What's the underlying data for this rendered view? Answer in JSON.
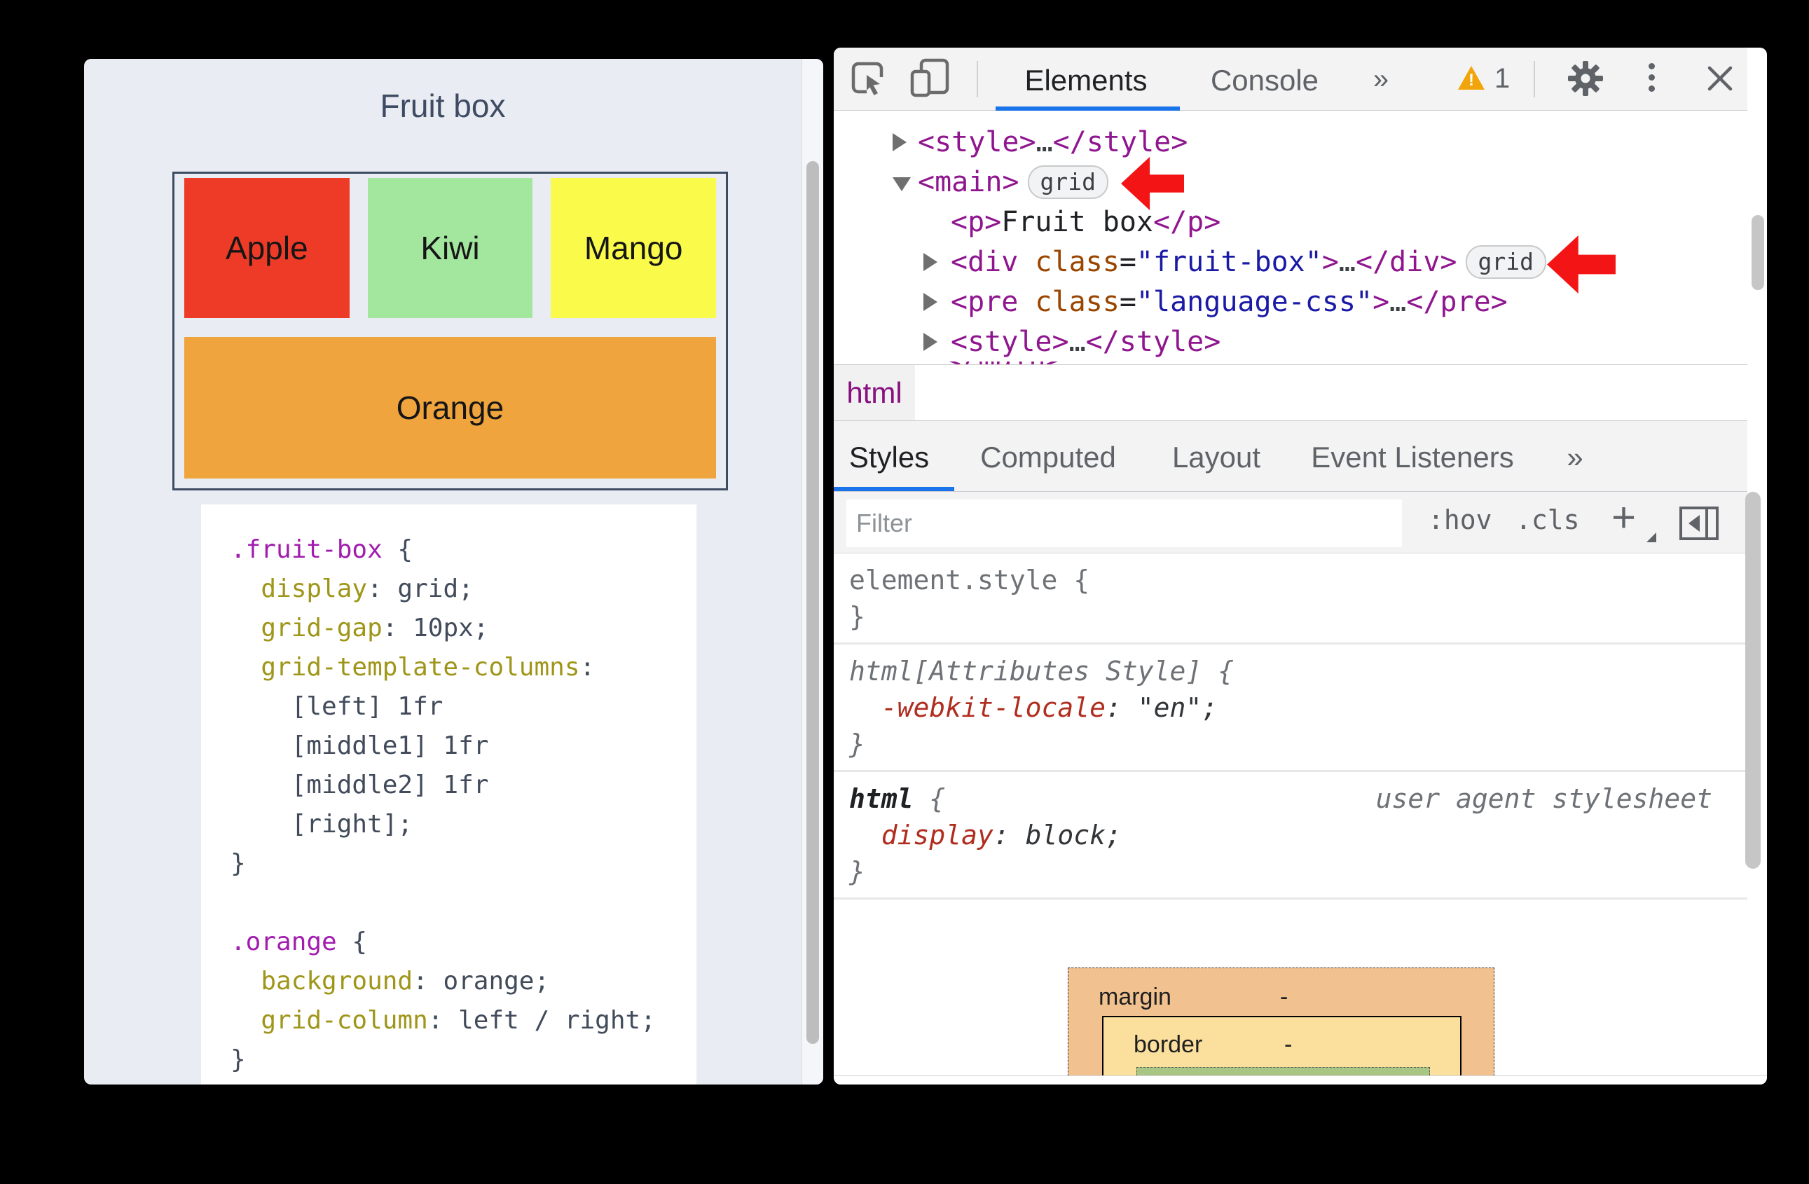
{
  "page": {
    "title": "Fruit box",
    "fruits": [
      {
        "label": "Apple",
        "color": "#ee3b28"
      },
      {
        "label": "Kiwi",
        "color": "#a3e69e"
      },
      {
        "label": "Mango",
        "color": "#fafa4a"
      },
      {
        "label": "Orange",
        "color": "#efa43d"
      }
    ],
    "code": {
      "lines": [
        {
          "a": ".fruit-box",
          "b": " {"
        },
        {
          "a": "  display",
          "b": ": grid;"
        },
        {
          "a": "  grid-gap",
          "b": ": 10px;"
        },
        {
          "a": "  grid-template-columns",
          "b": ":"
        },
        {
          "b": "    [left] 1fr"
        },
        {
          "b": "    [middle1] 1fr"
        },
        {
          "b": "    [middle2] 1fr"
        },
        {
          "b": "    [right];"
        },
        {
          "b": "}"
        },
        {
          "b": ""
        },
        {
          "a": ".orange",
          "b": " {"
        },
        {
          "a": "  background",
          "b": ": orange;"
        },
        {
          "a": "  grid-column",
          "b": ": left / right;"
        },
        {
          "b": "}"
        }
      ]
    }
  },
  "devtools": {
    "toolbar": {
      "tab_elements": "Elements",
      "tab_console": "Console",
      "more_tabs": "»",
      "warning_count": "1"
    },
    "dom": {
      "rows": [
        {
          "parts": [
            {
              "t": "<style>"
            },
            {
              "t": "…"
            },
            {
              "t": "</style>"
            }
          ]
        },
        {
          "parts": [
            {
              "t": "<main>"
            }
          ],
          "badge": "grid"
        },
        {
          "parts": [
            {
              "t": "<p>"
            },
            {
              "t": "Fruit box"
            },
            {
              "t": "</p>"
            }
          ]
        },
        {
          "parts": [
            {
              "t": "<div"
            },
            {
              "t": " class"
            },
            {
              "t": "="
            },
            {
              "t": "\"fruit-box\""
            },
            {
              "t": ">"
            },
            {
              "t": "…"
            },
            {
              "t": "</div>"
            }
          ],
          "badge": "grid"
        },
        {
          "parts": [
            {
              "t": "<pre"
            },
            {
              "t": " class"
            },
            {
              "t": "="
            },
            {
              "t": "\"language-css\""
            },
            {
              "t": ">"
            },
            {
              "t": "…"
            },
            {
              "t": "</pre>"
            }
          ]
        },
        {
          "parts": [
            {
              "t": "<style>"
            },
            {
              "t": "…"
            },
            {
              "t": "</style>"
            }
          ]
        },
        {
          "parts": [
            {
              "t": "</main>"
            }
          ]
        }
      ]
    },
    "breadcrumb": {
      "item": "html"
    },
    "sidebar_tabs": {
      "styles": "Styles",
      "computed": "Computed",
      "layout": "Layout",
      "event_listeners": "Event Listeners",
      "more": "»"
    },
    "filter": {
      "placeholder": "Filter",
      "pseudo_toggle": ":hov",
      "class_toggle": ".cls",
      "new_rule": "+"
    },
    "rules": {
      "element_style": {
        "open": "element.style {",
        "close": "}"
      },
      "attributes_style": {
        "selector": "html[Attributes Style] {",
        "property": "  -webkit-locale",
        "value": ": \"en\";",
        "close": "}"
      },
      "user_agent": {
        "selector": "html ",
        "brace": "{",
        "origin": "user agent stylesheet",
        "property": "  display",
        "value": ": block;",
        "close": "}"
      }
    },
    "box_model": {
      "margin_label": "margin",
      "margin_value": "-",
      "border_label": "border",
      "border_value": "-"
    },
    "accent_colors": {
      "active_tab_underline": "#1a73e8",
      "warning": "#f2a50a",
      "arrow_annotation": "#f31515",
      "badge_bg": "#f1f3f4"
    }
  }
}
